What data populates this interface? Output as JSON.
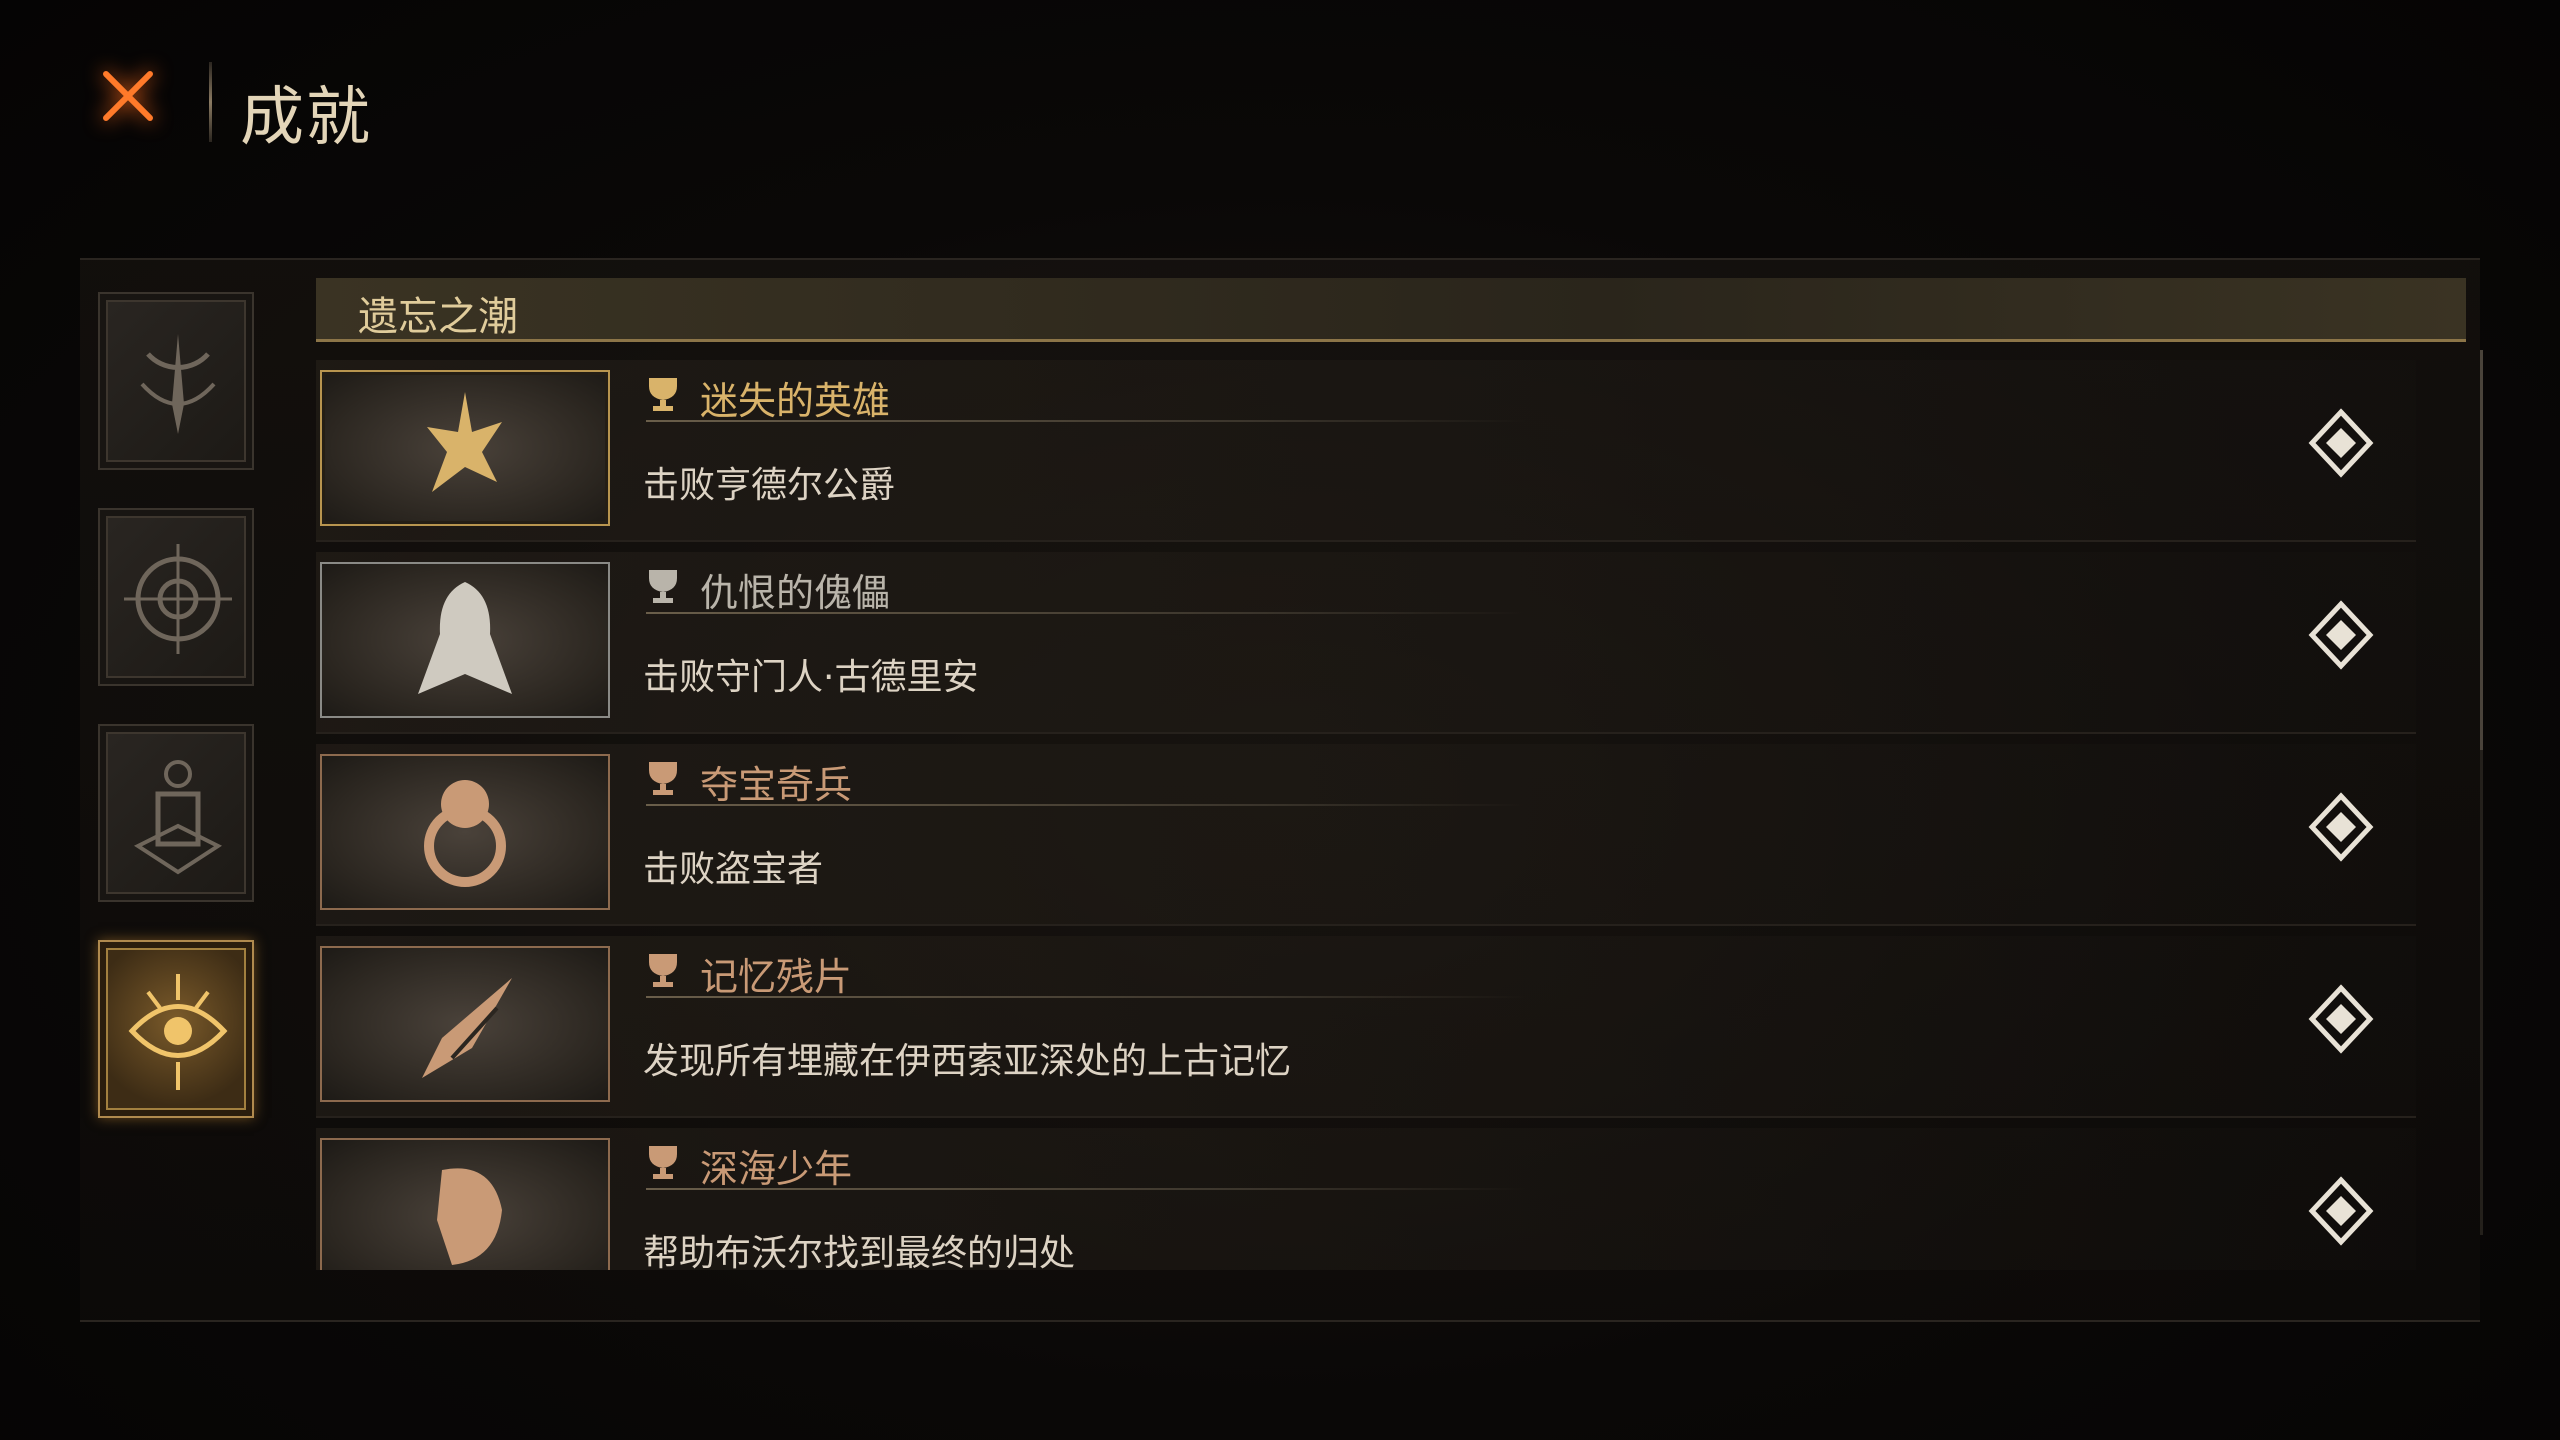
{
  "header": {
    "title": "成就"
  },
  "category": {
    "title": "遗忘之潮"
  },
  "side_tabs": [
    {
      "icon": "tide-symbol-icon",
      "active": false
    },
    {
      "icon": "compass-sigil-icon",
      "active": false
    },
    {
      "icon": "lantern-sigil-icon",
      "active": false
    },
    {
      "icon": "eye-sigil-icon",
      "active": true
    }
  ],
  "achievements": [
    {
      "title": "迷失的英雄",
      "desc": "击败亨德尔公爵",
      "tier": "gold",
      "title_color": "#d9b36a",
      "badge_icon": "duke-emblem-icon"
    },
    {
      "title": "仇恨的傀儡",
      "desc": "击败守门人·古德里安",
      "tier": "silver",
      "title_color": "#b9b4aa",
      "badge_icon": "gatekeeper-emblem-icon"
    },
    {
      "title": "夺宝奇兵",
      "desc": "击败盗宝者",
      "tier": "bronze",
      "title_color": "#c99a76",
      "badge_icon": "treasure-thief-emblem-icon"
    },
    {
      "title": "记忆残片",
      "desc": "发现所有埋藏在伊西索亚深处的上古记忆",
      "tier": "bronze",
      "title_color": "#c99a76",
      "badge_icon": "memory-shard-emblem-icon"
    },
    {
      "title": "深海少年",
      "desc": "帮助布沃尔找到最终的归处",
      "tier": "bronze",
      "title_color": "#c99a76",
      "badge_icon": "deep-sea-boy-emblem-icon"
    }
  ],
  "colors": {
    "accent_gold": "#d9b36a",
    "close_orange": "#ff7a2a"
  }
}
